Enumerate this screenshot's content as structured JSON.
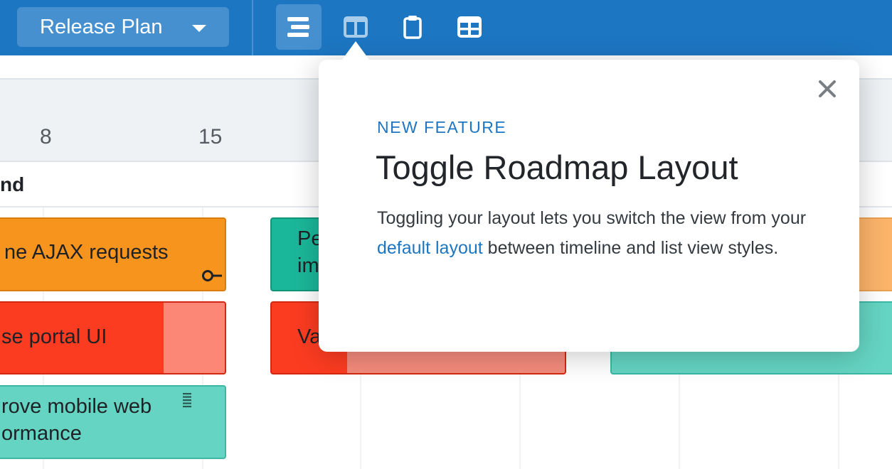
{
  "toolbar": {
    "plan_label": "Release Plan",
    "icons": [
      "timeline-view-icon",
      "columns-view-icon",
      "clipboard-icon",
      "table-view-icon"
    ],
    "brand_color": "#1d76c2"
  },
  "timeline": {
    "dates": [
      "8",
      "15"
    ],
    "group_title": "nd"
  },
  "bars": [
    {
      "name": "bar-ajax-requests",
      "text": "ne AJAX requests",
      "color": "orange"
    },
    {
      "name": "bar-pe",
      "text": "Pe",
      "text2": "im",
      "color": "teal"
    },
    {
      "name": "bar-portal-ui",
      "text": "se portal UI",
      "color": "red",
      "progress": 0.72
    },
    {
      "name": "bar-va",
      "text": "Va",
      "color": "red",
      "progress": 0.26
    },
    {
      "name": "bar-mobile-web",
      "text": "rove mobile web",
      "text2": "ormance",
      "color": "teal-light"
    }
  ],
  "popover": {
    "eyebrow": "NEW FEATURE",
    "title": "Toggle Roadmap Layout",
    "body_before": "Toggling your layout lets you switch the view from your ",
    "link_text": "default layout",
    "body_after": " between timeline and list view styles.",
    "close_icon": "close-icon"
  }
}
